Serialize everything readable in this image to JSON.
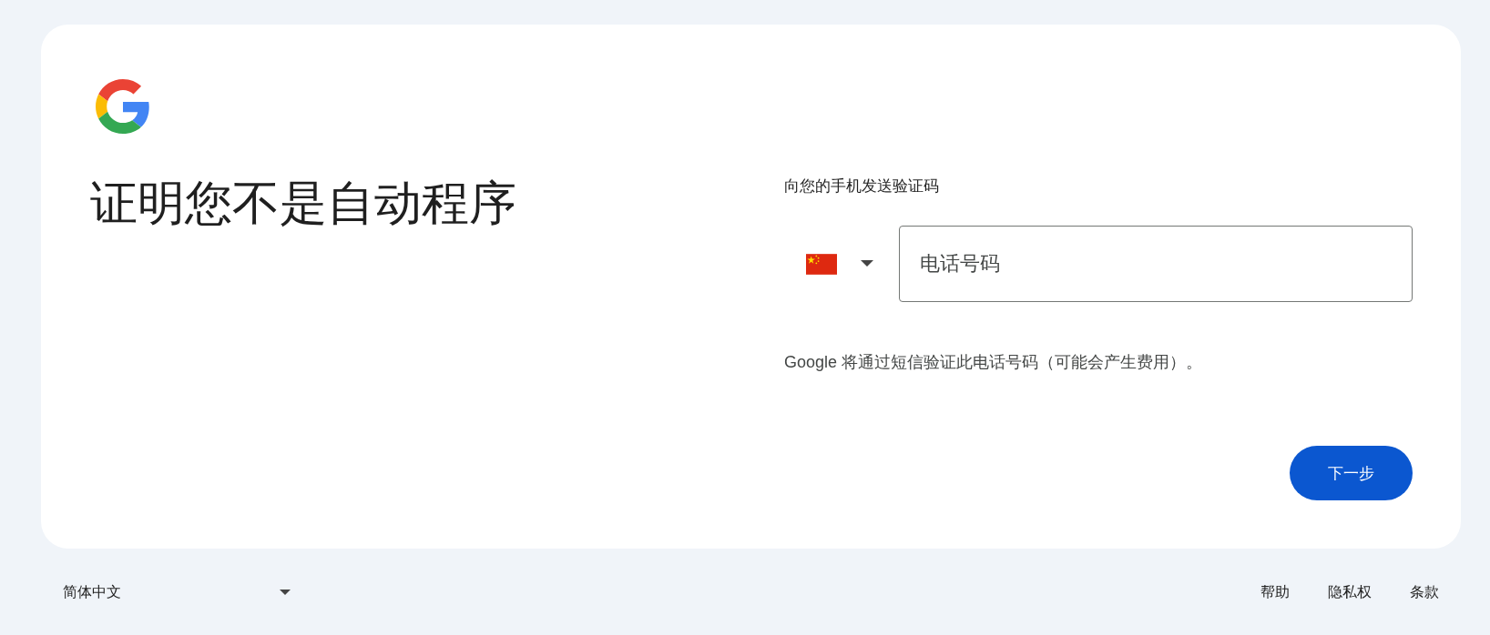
{
  "heading": "证明您不是自动程序",
  "phone_section": {
    "label": "向您的手机发送验证码",
    "phone_field": {
      "placeholder": "电话号码"
    },
    "note": "Google 将通过短信验证此电话号码（可能会产生费用）。"
  },
  "next_button": "下一步",
  "footer": {
    "language": "简体中文",
    "links": [
      "帮助",
      "隐私权",
      "条款"
    ]
  }
}
